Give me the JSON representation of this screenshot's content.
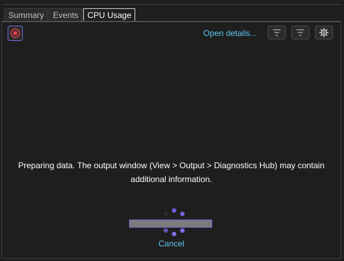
{
  "tabs": [
    {
      "label": "Summary",
      "active": false
    },
    {
      "label": "Events",
      "active": false
    },
    {
      "label": "CPU Usage",
      "active": true
    }
  ],
  "toolbar": {
    "record_icon": "stop-record-icon",
    "open_details_label": "Open details...",
    "filter_icon": "filter-icon",
    "filter2_icon": "filter-icon",
    "settings_icon": "gear-icon"
  },
  "status": {
    "message_line1": "Preparing data. The output window (View > Output > Diagnostics Hub) may contain",
    "message_line2": "additional information.",
    "cancel_label": "Cancel"
  },
  "colors": {
    "accent": "#7a6fe0",
    "link": "#5fc8f0",
    "record": "#e8414f"
  }
}
